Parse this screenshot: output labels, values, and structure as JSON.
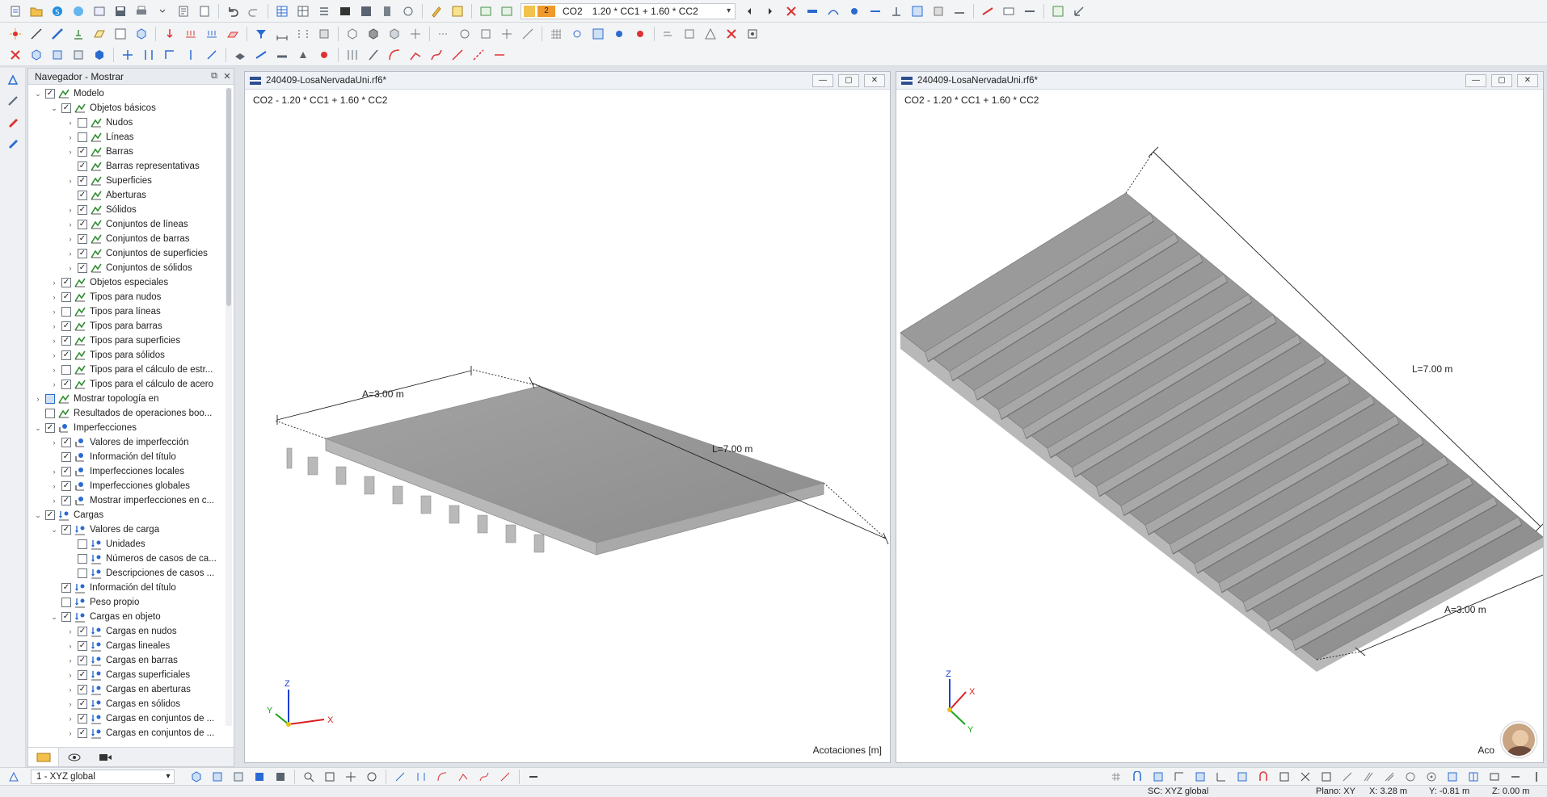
{
  "toolbar": {
    "combo_number": "2",
    "combo_code": "CO2",
    "combo_formula": "1.20 * CC1 + 1.60 * CC2"
  },
  "navigator": {
    "title": "Navegador - Mostrar",
    "items": [
      {
        "label": "Modelo",
        "level": 0,
        "toggle": "open",
        "checked": "yes",
        "icon": "model-icon"
      },
      {
        "label": "Objetos básicos",
        "level": 1,
        "toggle": "open",
        "checked": "yes",
        "icon": "model-icon"
      },
      {
        "label": "Nudos",
        "level": 2,
        "toggle": "closed",
        "checked": "no",
        "icon": "model-icon"
      },
      {
        "label": "Líneas",
        "level": 2,
        "toggle": "closed",
        "checked": "no",
        "icon": "model-icon"
      },
      {
        "label": "Barras",
        "level": 2,
        "toggle": "closed",
        "checked": "yes",
        "icon": "model-icon"
      },
      {
        "label": "Barras representativas",
        "level": 2,
        "toggle": "none",
        "checked": "yes",
        "icon": "model-icon"
      },
      {
        "label": "Superficies",
        "level": 2,
        "toggle": "closed",
        "checked": "yes",
        "icon": "model-icon"
      },
      {
        "label": "Aberturas",
        "level": 2,
        "toggle": "none",
        "checked": "yes",
        "icon": "model-icon"
      },
      {
        "label": "Sólidos",
        "level": 2,
        "toggle": "closed",
        "checked": "yes",
        "icon": "model-icon"
      },
      {
        "label": "Conjuntos de líneas",
        "level": 2,
        "toggle": "closed",
        "checked": "yes",
        "icon": "model-icon"
      },
      {
        "label": "Conjuntos de barras",
        "level": 2,
        "toggle": "closed",
        "checked": "yes",
        "icon": "model-icon"
      },
      {
        "label": "Conjuntos de superficies",
        "level": 2,
        "toggle": "closed",
        "checked": "yes",
        "icon": "model-icon"
      },
      {
        "label": "Conjuntos de sólidos",
        "level": 2,
        "toggle": "closed",
        "checked": "yes",
        "icon": "model-icon"
      },
      {
        "label": "Objetos especiales",
        "level": 1,
        "toggle": "closed",
        "checked": "yes",
        "icon": "model-icon"
      },
      {
        "label": "Tipos para nudos",
        "level": 1,
        "toggle": "closed",
        "checked": "yes",
        "icon": "model-icon"
      },
      {
        "label": "Tipos para líneas",
        "level": 1,
        "toggle": "closed",
        "checked": "no",
        "icon": "model-icon"
      },
      {
        "label": "Tipos para barras",
        "level": 1,
        "toggle": "closed",
        "checked": "yes",
        "icon": "model-icon"
      },
      {
        "label": "Tipos para superficies",
        "level": 1,
        "toggle": "closed",
        "checked": "yes",
        "icon": "model-icon"
      },
      {
        "label": "Tipos para sólidos",
        "level": 1,
        "toggle": "closed",
        "checked": "yes",
        "icon": "model-icon"
      },
      {
        "label": "Tipos para el cálculo de estr...",
        "level": 1,
        "toggle": "closed",
        "checked": "no",
        "icon": "model-icon"
      },
      {
        "label": "Tipos para el cálculo de acero",
        "level": 1,
        "toggle": "closed",
        "checked": "yes",
        "icon": "model-icon"
      },
      {
        "label": "Mostrar topología en",
        "level": 0,
        "toggle": "closed",
        "checked": "partial",
        "icon": "model-icon"
      },
      {
        "label": "Resultados de operaciones boo...",
        "level": 0,
        "toggle": "none",
        "checked": "no",
        "icon": "model-icon"
      },
      {
        "label": "Imperfecciones",
        "level": 0,
        "toggle": "open",
        "checked": "yes",
        "icon": "imperfection-icon"
      },
      {
        "label": "Valores de imperfección",
        "level": 1,
        "toggle": "closed",
        "checked": "yes",
        "icon": "imperfection-icon"
      },
      {
        "label": "Información del título",
        "level": 1,
        "toggle": "none",
        "checked": "yes",
        "icon": "imperfection-icon"
      },
      {
        "label": "Imperfecciones locales",
        "level": 1,
        "toggle": "closed",
        "checked": "yes",
        "icon": "imperfection-icon"
      },
      {
        "label": "Imperfecciones globales",
        "level": 1,
        "toggle": "closed",
        "checked": "yes",
        "icon": "imperfection-icon"
      },
      {
        "label": "Mostrar imperfecciones en c...",
        "level": 1,
        "toggle": "closed",
        "checked": "yes",
        "icon": "imperfection-icon"
      },
      {
        "label": "Cargas",
        "level": 0,
        "toggle": "open",
        "checked": "yes",
        "icon": "load-icon"
      },
      {
        "label": "Valores de carga",
        "level": 1,
        "toggle": "open",
        "checked": "yes",
        "icon": "load-icon"
      },
      {
        "label": "Unidades",
        "level": 2,
        "toggle": "none",
        "checked": "no",
        "icon": "load-icon"
      },
      {
        "label": "Números de casos de ca...",
        "level": 2,
        "toggle": "none",
        "checked": "no",
        "icon": "load-icon"
      },
      {
        "label": "Descripciones de casos ...",
        "level": 2,
        "toggle": "none",
        "checked": "no",
        "icon": "load-icon"
      },
      {
        "label": "Información del título",
        "level": 1,
        "toggle": "none",
        "checked": "yes",
        "icon": "load-icon"
      },
      {
        "label": "Peso propio",
        "level": 1,
        "toggle": "none",
        "checked": "no",
        "icon": "load-icon"
      },
      {
        "label": "Cargas en objeto",
        "level": 1,
        "toggle": "open",
        "checked": "yes",
        "icon": "load-icon"
      },
      {
        "label": "Cargas en nudos",
        "level": 2,
        "toggle": "closed",
        "checked": "yes",
        "icon": "load-icon"
      },
      {
        "label": "Cargas lineales",
        "level": 2,
        "toggle": "closed",
        "checked": "yes",
        "icon": "load-icon"
      },
      {
        "label": "Cargas en barras",
        "level": 2,
        "toggle": "closed",
        "checked": "yes",
        "icon": "load-icon"
      },
      {
        "label": "Cargas superficiales",
        "level": 2,
        "toggle": "closed",
        "checked": "yes",
        "icon": "load-icon"
      },
      {
        "label": "Cargas en aberturas",
        "level": 2,
        "toggle": "closed",
        "checked": "yes",
        "icon": "load-icon"
      },
      {
        "label": "Cargas en sólidos",
        "level": 2,
        "toggle": "closed",
        "checked": "yes",
        "icon": "load-icon"
      },
      {
        "label": "Cargas en conjuntos de ...",
        "level": 2,
        "toggle": "closed",
        "checked": "yes",
        "icon": "load-icon"
      },
      {
        "label": "Cargas en conjuntos de ...",
        "level": 2,
        "toggle": "closed",
        "checked": "yes",
        "icon": "load-icon"
      }
    ]
  },
  "viewports": {
    "left": {
      "file": "240409-LosaNervadaUni.rf6*",
      "combo": "CO2 - 1.20 * CC1 + 1.60 * CC2",
      "dim_a": "A=3.00 m",
      "dim_l": "L=7.00 m",
      "dims_label": "Acotaciones [m]"
    },
    "right": {
      "file": "240409-LosaNervadaUni.rf6*",
      "combo": "CO2 - 1.20 * CC1 + 1.60 * CC2",
      "dim_a": "A=3.00 m",
      "dim_l": "L=7.00 m",
      "dims_label": "Aco"
    },
    "axes": {
      "x": "X",
      "y": "Y",
      "z": "Z"
    }
  },
  "bottom": {
    "view_name": "1 - XYZ global"
  },
  "status": {
    "cs": "SC: XYZ global",
    "plane": "Plano: XY",
    "x": "X: 3.28 m",
    "y": "Y: -0.81 m",
    "z": "Z: 0.00 m"
  },
  "colors": {
    "concrete_top": "#9a9a9a",
    "concrete_side": "#b6b6b6",
    "accent": "#2a6bd1"
  }
}
